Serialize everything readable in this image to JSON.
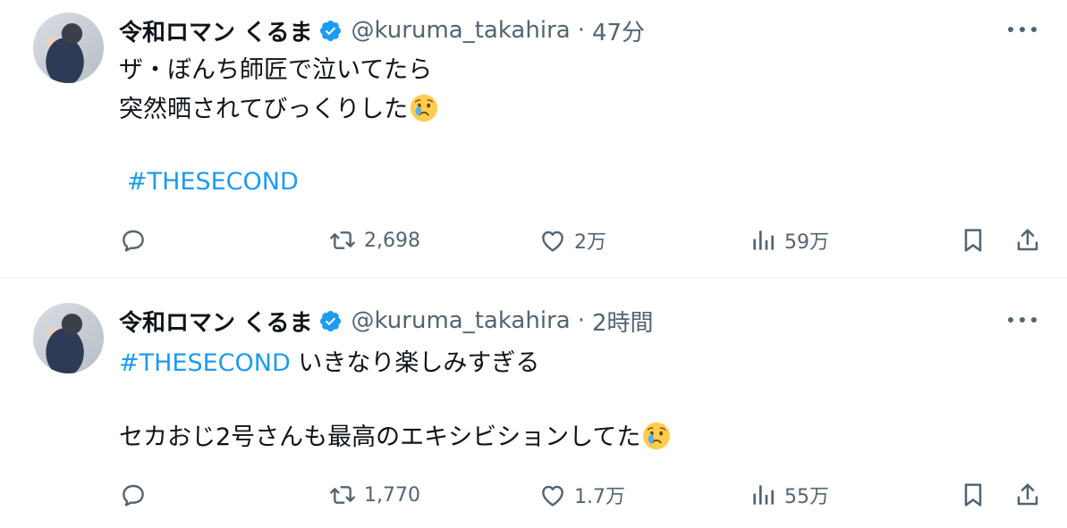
{
  "tweets": [
    {
      "name": "令和ロマン くるま",
      "handle": "@kuruma_takahira",
      "separator": "·",
      "time": "47分",
      "line_a": "ザ・ぼんち師匠で泣いてたら",
      "line_b": "突然晒されてびっくりした",
      "hashtag": "#THESECOND",
      "stats": {
        "retweets": "2,698",
        "likes": "2万",
        "views": "59万"
      }
    },
    {
      "name": "令和ロマン くるま",
      "handle": "@kuruma_takahira",
      "separator": "·",
      "time": "2時間",
      "hashtag": "#THESECOND",
      "line_a_rest": " いきなり楽しみすぎる",
      "line_b": "セカおじ2号さんも最高のエキシビションしてた",
      "stats": {
        "retweets": "1,770",
        "likes": "1.7万",
        "views": "55万"
      }
    }
  ],
  "icons": {
    "verified": "verified-badge-icon",
    "more": "more-icon",
    "reply": "reply-icon",
    "retweet": "retweet-icon",
    "like": "heart-icon",
    "views": "views-icon",
    "bookmark": "bookmark-icon",
    "share": "share-icon",
    "emoji": "crying-face-emoji"
  },
  "colors": {
    "accent": "#1d9bf0",
    "text": "#0f1419",
    "secondary": "#536471"
  }
}
